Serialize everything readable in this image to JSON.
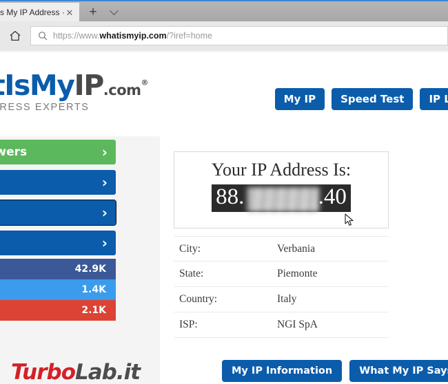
{
  "browser": {
    "tab": {
      "title": "s My IP Address ·",
      "close_label": "✕"
    },
    "new_tab_label": "+",
    "tab_menu_icon": "chevron-down-icon",
    "home_icon": "home-icon",
    "search_icon": "search-icon",
    "url": {
      "prefix": "https://www.",
      "domain": "whatismyip.com",
      "suffix": "/?iref=home",
      "full": "https://www.whatismyip.com/?iref=home"
    }
  },
  "site": {
    "logo": {
      "part_blue": "atIsMy",
      "part_gray": "IP",
      "dotcom": ".com",
      "registered": "®",
      "tagline": "ADDRESS EXPERTS"
    },
    "topnav": [
      {
        "label": "My IP"
      },
      {
        "label": "Speed Test"
      },
      {
        "label": "IP Loc"
      }
    ]
  },
  "sidebar": {
    "buttons": [
      {
        "label": "Answers",
        "color": "#5cb85c",
        "chevron": "›",
        "focused": false
      },
      {
        "label": "",
        "color": "#0b5cab",
        "chevron": "›",
        "focused": false
      },
      {
        "label": "",
        "color": "#0b5cab",
        "chevron": "›",
        "focused": true
      },
      {
        "label": "",
        "color": "#0b5cab",
        "chevron": "›",
        "focused": false
      }
    ],
    "socials": [
      {
        "count": "42.9K",
        "color": "#3b5998"
      },
      {
        "count": "1.4K",
        "color": "#3b9ced"
      },
      {
        "count": "2.1K",
        "color": "#dc4334"
      }
    ]
  },
  "watermark": {
    "red": "Turbo",
    "gray": "Lab.it"
  },
  "main": {
    "ip_card": {
      "title": "Your IP Address Is:",
      "ip_prefix": "88.",
      "ip_suffix": ".40",
      "ip_masked": true
    },
    "info_rows": [
      {
        "key": "City:",
        "value": "Verbania"
      },
      {
        "key": "State:",
        "value": "Piemonte"
      },
      {
        "key": "Country:",
        "value": "Italy"
      },
      {
        "key": "ISP:",
        "value": "NGI SpA"
      }
    ],
    "bottom_buttons": [
      {
        "label": "My IP Information"
      },
      {
        "label": "What My IP Says Ab"
      }
    ]
  },
  "colors": {
    "brand_blue": "#0b5cab",
    "brand_green": "#5cb85c",
    "page_bg": "#f4f4f4",
    "accent_red": "#d42027"
  }
}
